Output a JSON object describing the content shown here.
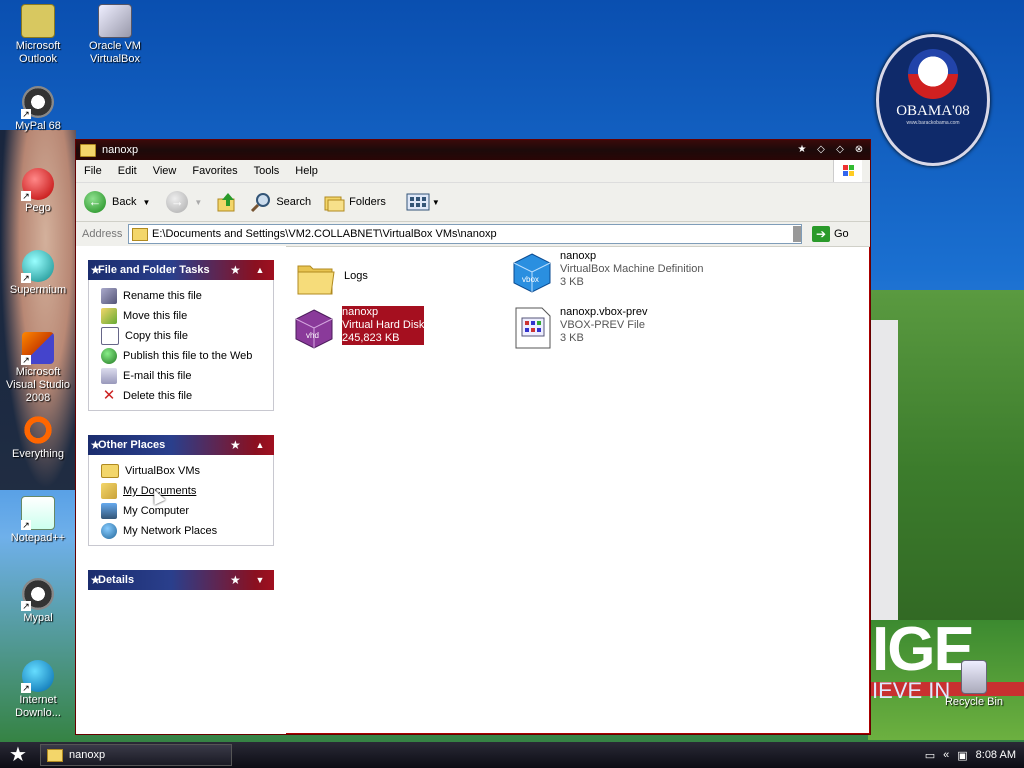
{
  "desktop": {
    "icons": [
      {
        "label": "Microsoft Outlook",
        "icon": "outlook-icon"
      },
      {
        "label": "Oracle VM VirtualBox",
        "icon": "virtualbox-icon"
      },
      {
        "label": "MyPal 68",
        "icon": "mypal-icon"
      },
      {
        "label": "Pego",
        "icon": "pego-icon"
      },
      {
        "label": "Supermium",
        "icon": "supermium-icon"
      },
      {
        "label": "Microsoft Visual Studio 2008",
        "icon": "visual-studio-icon"
      },
      {
        "label": "Everything",
        "icon": "everything-icon"
      },
      {
        "label": "Notepad++",
        "icon": "notepadpp-icon"
      },
      {
        "label": "Mypal",
        "icon": "mypal-icon"
      },
      {
        "label": "Internet Downlo...",
        "icon": "internet-download-icon"
      },
      {
        "label": "Recycle Bin",
        "icon": "recycle-bin-icon"
      }
    ],
    "logo": {
      "text": "OBAMA'08",
      "sub": "www.barackobama.com"
    },
    "wallpaper_text": {
      "big": "IGE",
      "small": "IEVE IN"
    }
  },
  "window": {
    "title": "nanoxp",
    "menu": [
      "File",
      "Edit",
      "View",
      "Favorites",
      "Tools",
      "Help"
    ],
    "toolbar": {
      "back": "Back",
      "search": "Search",
      "folders": "Folders"
    },
    "address": {
      "label": "Address",
      "path": "E:\\Documents and Settings\\VM2.COLLABNET\\VirtualBox VMs\\nanoxp",
      "go": "Go"
    },
    "panels": {
      "file_tasks": {
        "title": "File and Folder Tasks",
        "items": [
          {
            "label": "Rename this file",
            "icon": "rename-icon"
          },
          {
            "label": "Move this file",
            "icon": "move-icon"
          },
          {
            "label": "Copy this file",
            "icon": "copy-icon"
          },
          {
            "label": "Publish this file to the Web",
            "icon": "publish-icon"
          },
          {
            "label": "E-mail this file",
            "icon": "email-icon"
          },
          {
            "label": "Delete this file",
            "icon": "delete-icon"
          }
        ]
      },
      "other_places": {
        "title": "Other Places",
        "items": [
          {
            "label": "VirtualBox VMs",
            "icon": "folder-icon"
          },
          {
            "label": "My Documents",
            "icon": "my-documents-icon"
          },
          {
            "label": "My Computer",
            "icon": "my-computer-icon"
          },
          {
            "label": "My Network Places",
            "icon": "network-places-icon"
          }
        ]
      },
      "details": {
        "title": "Details"
      }
    },
    "files": [
      {
        "name": "Logs",
        "type": "",
        "size": "",
        "icon": "folder-icon"
      },
      {
        "name": "nanoxp",
        "type": "VirtualBox Machine Definition",
        "size": "3 KB",
        "icon": "vbox-icon"
      },
      {
        "name": "nanoxp",
        "type": "Virtual Hard Disk",
        "size": "245,823 KB",
        "icon": "vhd-icon",
        "selected": true
      },
      {
        "name": "nanoxp.vbox-prev",
        "type": "VBOX-PREV File",
        "size": "3 KB",
        "icon": "generic-file-icon"
      }
    ]
  },
  "taskbar": {
    "task": "nanoxp",
    "time": "8:08 AM"
  },
  "colors": {
    "selection": "#a50f1f",
    "titlebar": "#1c0a0a",
    "panel_blue": "#1b2d6e",
    "panel_red": "#a01020"
  }
}
